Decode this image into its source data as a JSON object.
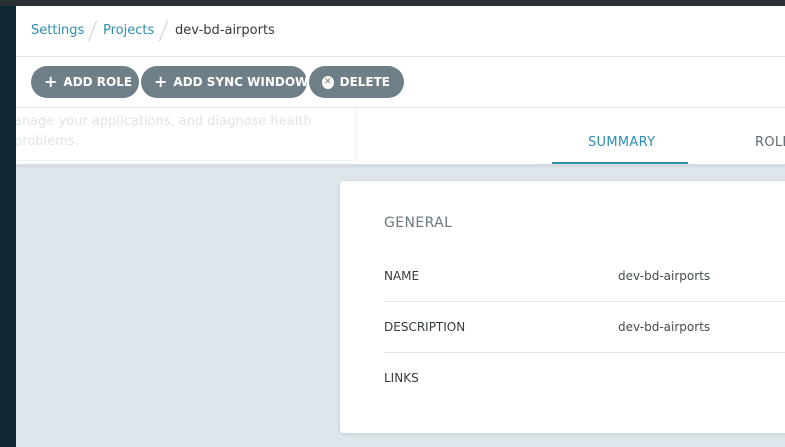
{
  "breadcrumb": {
    "items": [
      {
        "label": "Settings"
      },
      {
        "label": "Projects"
      },
      {
        "label": "dev-bd-airports"
      }
    ]
  },
  "toolbar": {
    "add_role": "ADD ROLE",
    "add_sync_window": "ADD SYNC WINDOW",
    "delete": "DELETE"
  },
  "background_hint": {
    "line1": "anage your applications, and diagnose health",
    "line2": "problems."
  },
  "tabs": [
    {
      "label": "SUMMARY",
      "active": true
    },
    {
      "label": "ROLE",
      "active": false
    }
  ],
  "summary": {
    "section_title": "GENERAL",
    "rows": [
      {
        "label": "NAME",
        "value": "dev-bd-airports"
      },
      {
        "label": "DESCRIPTION",
        "value": "dev-bd-airports"
      },
      {
        "label": "LINKS",
        "value": ""
      }
    ]
  },
  "colors": {
    "accent": "#2a8fb0",
    "button_bg": "#6e7f88",
    "page_bg": "#dee6eb",
    "sidebar": "#0f2733"
  }
}
